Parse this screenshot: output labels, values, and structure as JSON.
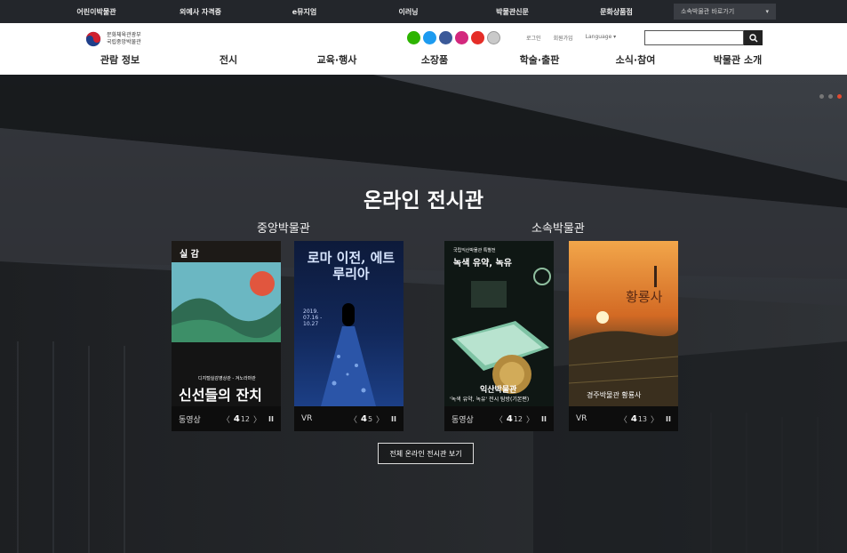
{
  "topbar": {
    "items": [
      "어린이박물관",
      "외예사 자격증",
      "e뮤지엄",
      "이러닝",
      "박물관신문",
      "문화상품점"
    ],
    "select_label": "소속박물관 바로가기",
    "select_arrow": "▾"
  },
  "header": {
    "logo_line1": "문화체육관광부",
    "logo_line2": "국립중앙박물관",
    "util_links": [
      "로그인",
      "회원가입",
      "Language ▾"
    ],
    "search_placeholder": "",
    "search_icon": "magnifier-icon",
    "social_icons": [
      {
        "name": "naver-blog-icon",
        "color": "#2db400"
      },
      {
        "name": "twitter-icon",
        "color": "#1d9bf0"
      },
      {
        "name": "facebook-icon",
        "color": "#3b5998"
      },
      {
        "name": "instagram-icon",
        "color": "#d3287d"
      },
      {
        "name": "youtube-icon",
        "color": "#e52d27"
      },
      {
        "name": "kakao-icon",
        "color": "#c9c9c9"
      }
    ]
  },
  "nav": {
    "items": [
      "관람 정보",
      "전시",
      "교육·행사",
      "소장품",
      "학술·출판",
      "소식·참여",
      "박물관 소개"
    ]
  },
  "hero": {
    "title": "온라인 전시관",
    "left_section": "중앙박물관",
    "right_section": "소속박물관",
    "view_all": "전체 온라인 전시관 보기",
    "accent": "#e2492f"
  },
  "cards": [
    {
      "poster_top": "실 감",
      "poster_sub": "디지털실감영상관 - 겨노라마관",
      "poster_title": "신선들의 잔치",
      "type": "동영상",
      "current": "4",
      "total": "12"
    },
    {
      "poster_title": "로마 이전, 에트루리아",
      "poster_date": "2019. 07.16 - 10.27",
      "type": "VR",
      "current": "4",
      "total": "5"
    },
    {
      "poster_top": "국립익산박물관 특별전",
      "poster_title": "녹색 유약, 녹유",
      "poster_caption1": "익산박물관",
      "poster_caption2": "'녹색 유약, 녹유' 전시 탐방(기본편)",
      "type": "동영상",
      "current": "4",
      "total": "12"
    },
    {
      "poster_title": "황룡사",
      "poster_caption1": "경주박물관 황룡사",
      "type": "VR",
      "current": "4",
      "total": "13"
    }
  ],
  "controls": {
    "prev": "〈",
    "next": "〉",
    "pause": "II"
  }
}
